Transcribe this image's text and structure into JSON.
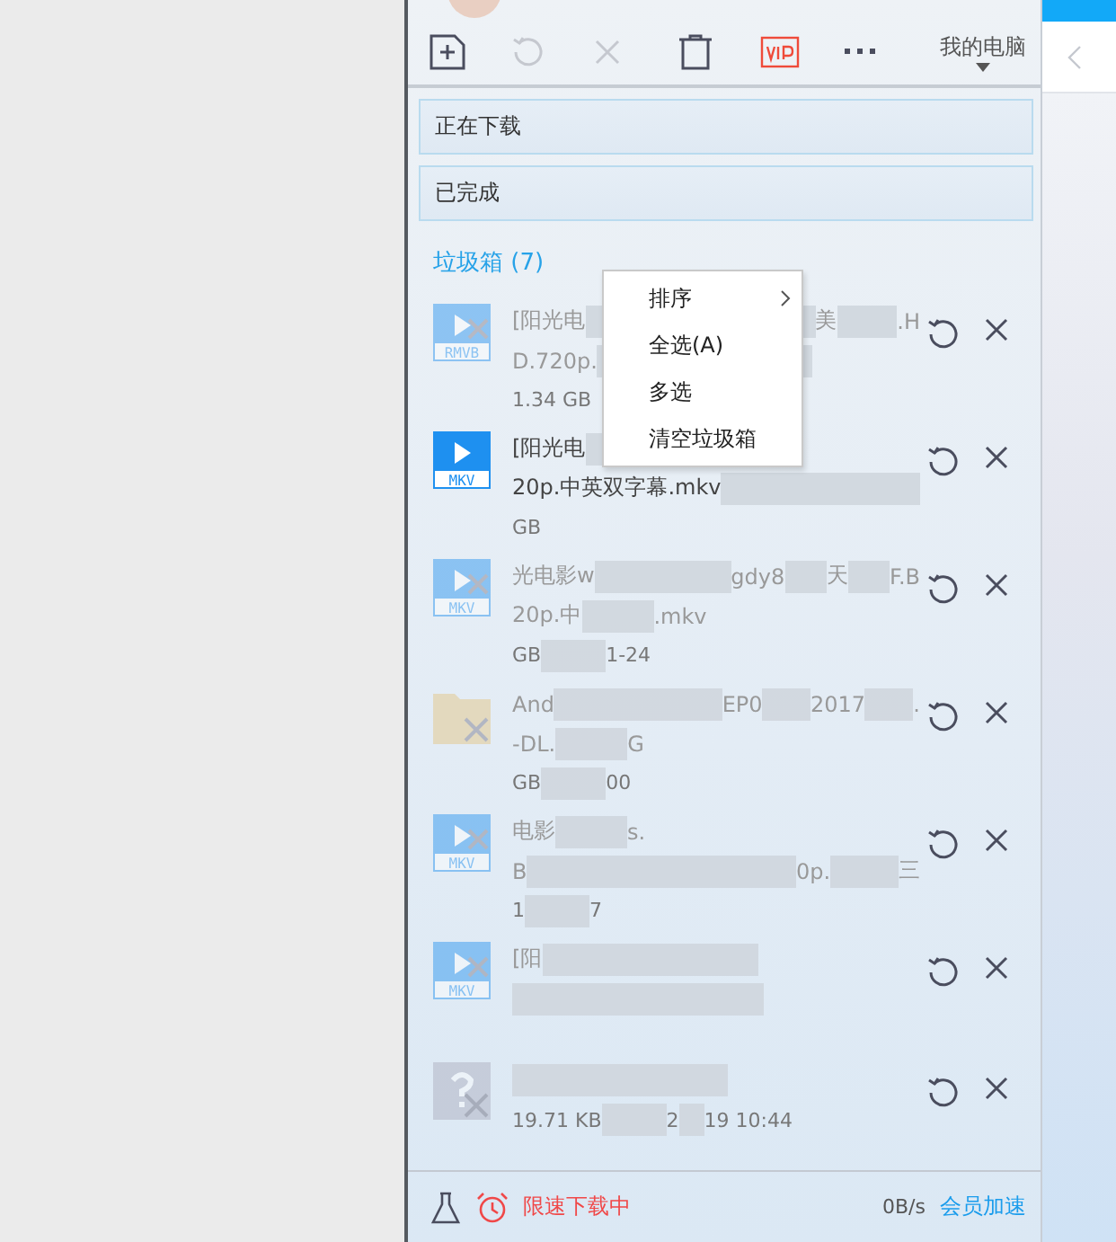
{
  "toolbar": {
    "location": "我的电脑"
  },
  "sections": [
    {
      "label": "正在下载"
    },
    {
      "label": "已完成"
    }
  ],
  "trash": {
    "label": "垃圾箱 (7)"
  },
  "context_menu": [
    {
      "label": "排序",
      "submenu": true
    },
    {
      "label": "全选(A)",
      "submenu": false
    },
    {
      "label": "多选",
      "submenu": false
    },
    {
      "label": "清空垃圾箱",
      "submenu": false
    }
  ],
  "items": [
    {
      "kind": "rmvb",
      "type_label": "RMVB",
      "dimmed": true,
      "lines": [
        [
          "[阳光电",
          "美",
          ".H"
        ],
        [
          "D.720p."
        ]
      ],
      "meta": [
        "1.34 GB"
      ]
    },
    {
      "kind": "video",
      "type_label": "MKV",
      "dimmed": false,
      "lines": [
        [
          "[阳光电"
        ],
        [
          "20p.中英双字幕.mkv"
        ]
      ],
      "meta": [
        "GB"
      ]
    },
    {
      "kind": "video",
      "type_label": "MKV",
      "dimmed": true,
      "lines": [
        [
          "光电影w",
          "gdy8",
          "天",
          "F.B"
        ],
        [
          "20p.中",
          ".mkv"
        ]
      ],
      "meta": [
        "GB",
        "1-24"
      ]
    },
    {
      "kind": "folder",
      "dimmed": true,
      "lines": [
        [
          "And",
          "EP0",
          "2017",
          "."
        ],
        [
          "-DL.",
          "G"
        ]
      ],
      "meta": [
        "GB",
        "00"
      ]
    },
    {
      "kind": "video",
      "type_label": "MKV",
      "dimmed": true,
      "lines": [
        [
          "电影",
          "s."
        ],
        [
          "B",
          "0p.",
          "三"
        ]
      ],
      "meta": [
        "1",
        "7"
      ]
    },
    {
      "kind": "video",
      "type_label": "MKV",
      "dimmed": true,
      "lines": [
        [
          "[阳"
        ]
      ]
    },
    {
      "kind": "unknown",
      "dimmed": true,
      "meta": [
        "19.71 KB",
        "2",
        "19 10:44"
      ]
    }
  ],
  "footer": {
    "status": "限速下载中",
    "speed": "0B/s",
    "boost_link": "会员加速"
  }
}
